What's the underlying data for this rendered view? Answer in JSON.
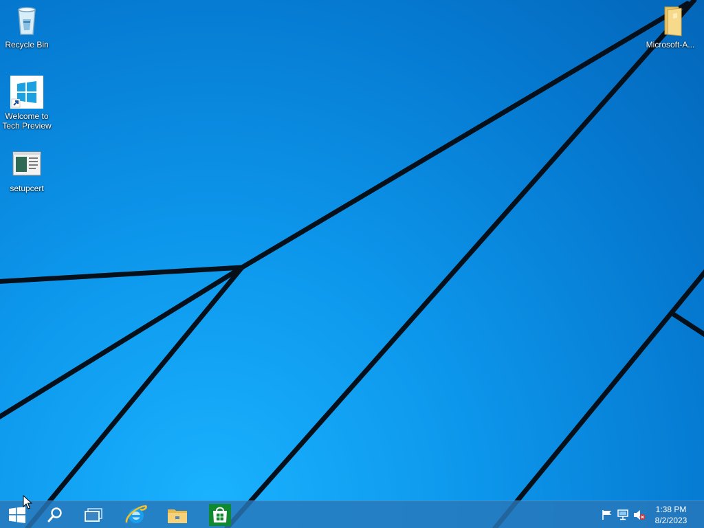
{
  "desktop": {
    "icons": [
      {
        "id": "recycle-bin",
        "label": "Recycle Bin",
        "icon": "recycle-bin-icon"
      },
      {
        "id": "welcome",
        "label": "Welcome to Tech Preview",
        "icon": "windows-logo-shortcut-icon"
      },
      {
        "id": "setupcert",
        "label": "setupcert",
        "icon": "application-window-icon"
      },
      {
        "id": "microsoft-folder",
        "label": "Microsoft-A...",
        "icon": "folder-icon"
      }
    ]
  },
  "taskbar": {
    "buttons": [
      {
        "name": "start-button",
        "icon": "windows-logo-icon"
      },
      {
        "name": "search-button",
        "icon": "search-icon"
      },
      {
        "name": "task-view-button",
        "icon": "task-view-icon"
      },
      {
        "name": "internet-explorer-button",
        "icon": "internet-explorer-icon"
      },
      {
        "name": "file-explorer-button",
        "icon": "folder-icon"
      },
      {
        "name": "store-button",
        "icon": "store-icon"
      }
    ],
    "tray": {
      "icons": [
        "action-center-flag-icon",
        "network-icon",
        "volume-muted-icon"
      ],
      "time": "1:38 PM",
      "date": "8/2/2023"
    }
  },
  "colors": {
    "wallpaper": "#0a8fe6",
    "taskbar": "#2878b9",
    "store": "#0f8a2e",
    "ie": "#1a9ff0"
  }
}
